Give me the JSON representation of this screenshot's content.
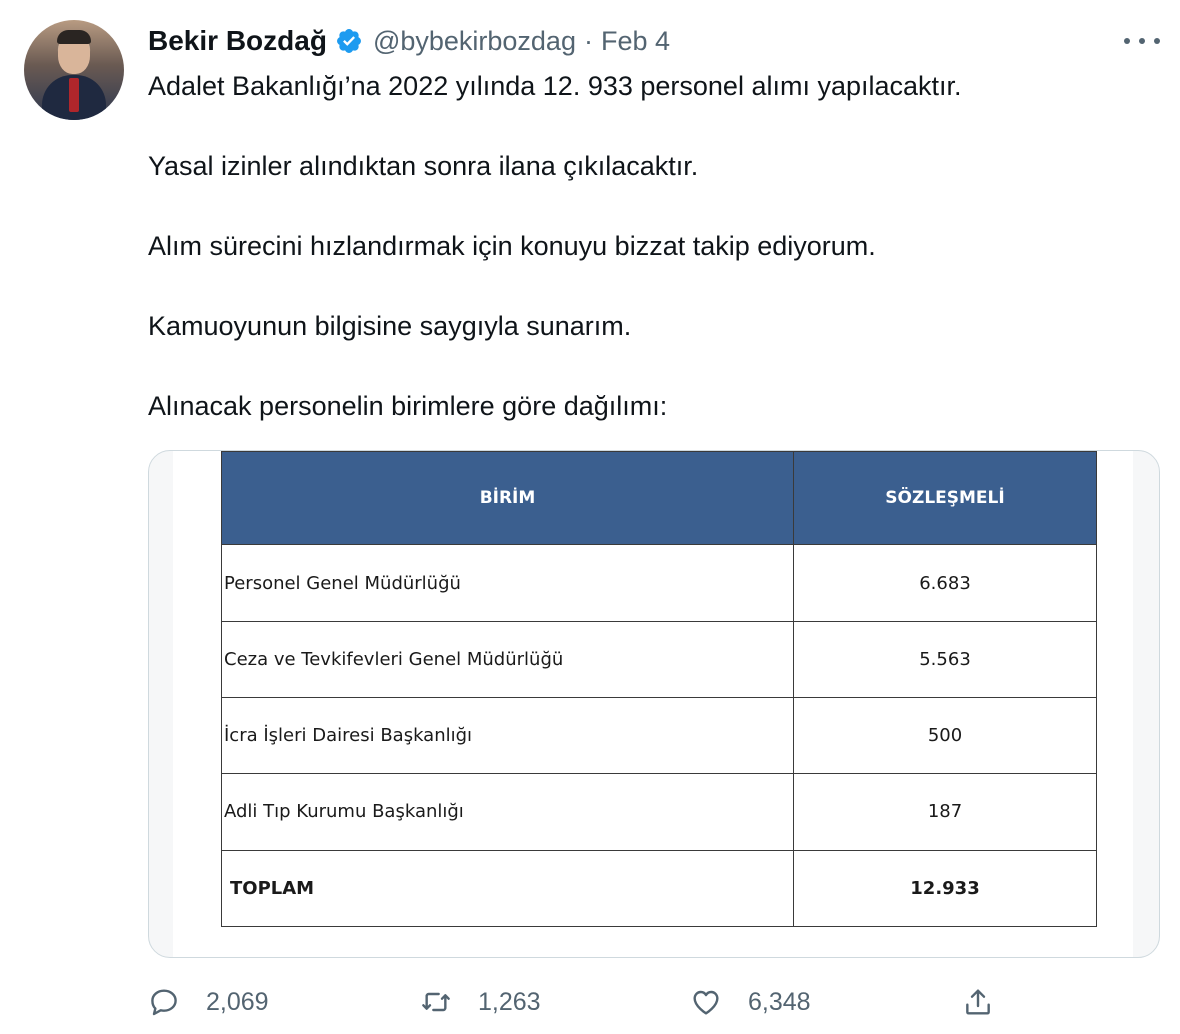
{
  "author": {
    "name": "Bekir Bozdağ",
    "handle": "@bybekirbozdag",
    "separator": "·",
    "date": "Feb 4"
  },
  "tweet": {
    "paragraphs": [
      "Adalet Bakanlığı’na 2022 yılında 12. 933 personel alımı yapılacaktır.",
      "Yasal izinler alındıktan sonra ilana çıkılacaktır.",
      "Alım sürecini hızlandırmak için konuyu bizzat takip ediyorum.",
      "Kamuoyunun bilgisine saygıyla sunarım.",
      "Alınacak personelin birimlere göre dağılımı:"
    ]
  },
  "media_table": {
    "headers": [
      "BİRİM",
      "SÖZLEŞMELİ"
    ],
    "rows": [
      {
        "unit": "Personel Genel Müdürlüğü",
        "count": "6.683"
      },
      {
        "unit": "Ceza ve Tevkifevleri Genel Müdürlüğü",
        "count": "5.563"
      },
      {
        "unit": "İcra İşleri Dairesi Başkanlığı",
        "count": "500"
      },
      {
        "unit": "Adli Tıp Kurumu Başkanlığı",
        "count": "187"
      }
    ],
    "total": {
      "unit": "TOPLAM",
      "count": "12.933"
    },
    "header_color": "#3b5f8f"
  },
  "actions": {
    "replies": "2,069",
    "retweets": "1,263",
    "likes": "6,348"
  },
  "colors": {
    "verified": "#1d9bf0",
    "secondary_text": "#536471"
  },
  "icons": {
    "verified": "verified-badge-icon",
    "more": "more-icon",
    "reply": "reply-icon",
    "retweet": "retweet-icon",
    "like": "heart-icon",
    "share": "share-icon"
  }
}
